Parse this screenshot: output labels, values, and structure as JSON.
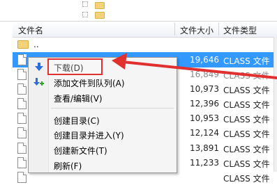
{
  "header": {
    "name": "文件名",
    "size": "文件大小",
    "type": "文件类型"
  },
  "parent_row": {
    "name": ".."
  },
  "files": [
    {
      "size": "19,646",
      "type": "CLASS 文件",
      "selected": true
    },
    {
      "size": "16,849",
      "type": "CLASS 文件",
      "selected": false
    },
    {
      "size": "10,973",
      "type": "CLASS 文件",
      "selected": false
    },
    {
      "size": "12,396",
      "type": "CLASS 文件",
      "selected": false
    },
    {
      "size": "10,953",
      "type": "CLASS 文件",
      "selected": false
    },
    {
      "size": "12,124",
      "type": "CLASS 文件",
      "selected": false
    },
    {
      "size": "13,891",
      "type": "CLASS 文件",
      "selected": false
    },
    {
      "size": "11,233",
      "type": "CLASS 文件",
      "selected": false
    },
    {
      "size": "",
      "type": "CLASS 文件",
      "selected": false
    }
  ],
  "context_menu": {
    "items": [
      {
        "label": "下载(D)",
        "icon": "download-arrow-icon"
      },
      {
        "label": "添加文件到队列(A)",
        "icon": "add-to-queue-icon"
      },
      {
        "label": "查看/编辑(V)",
        "icon": ""
      },
      {
        "label": "创建目录(C)",
        "icon": ""
      },
      {
        "label": "创建目录并进入(Y)",
        "icon": ""
      },
      {
        "label": "创建新文件(T)",
        "icon": ""
      },
      {
        "label": "刷新(F)",
        "icon": ""
      }
    ]
  },
  "colors": {
    "selection": "#3399ff",
    "annotation": "#e03030"
  }
}
